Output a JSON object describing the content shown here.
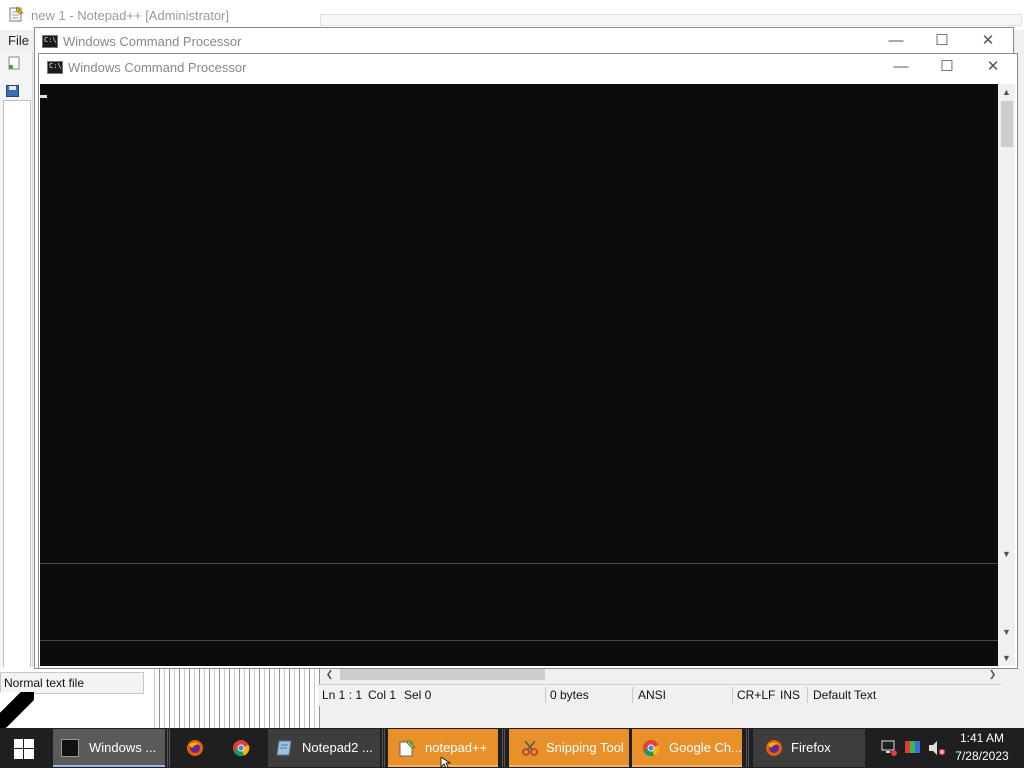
{
  "notepadpp": {
    "title": "new 1 - Notepad++ [Administrator]",
    "menu_file": "File",
    "status_left": "Normal text file"
  },
  "cmd_back": {
    "title": "Windows Command Processor"
  },
  "cmd_front": {
    "title": "Windows Command Processor"
  },
  "notepad2_status": {
    "position": "Ln 1 : 1",
    "col": "Col 1",
    "sel": "Sel 0",
    "size": "0 bytes",
    "encoding": "ANSI",
    "line_endings": "CR+LF",
    "mode": "INS",
    "scheme": "Default Text"
  },
  "taskbar": {
    "items": [
      {
        "label": "Windows ...",
        "icon": "cmd-icon"
      },
      {
        "label": "",
        "icon": "firefox-icon"
      },
      {
        "label": "",
        "icon": "chrome-icon"
      },
      {
        "label": "Notepad2 ...",
        "icon": "notepad2-icon"
      },
      {
        "label": "notepad++",
        "icon": "notepadpp-icon"
      },
      {
        "label": "Snipping Tool",
        "icon": "scissors-icon"
      },
      {
        "label": "Google Ch...",
        "icon": "chrome-icon"
      },
      {
        "label": "Firefox",
        "icon": "firefox-icon"
      }
    ],
    "clock_time": "1:41 AM",
    "clock_date": "7/28/2023"
  },
  "colors": {
    "console_bg": "#0c0c0c",
    "taskbar_bg": "#1f1f1f",
    "taskbar_active_orange": "#e8902a"
  }
}
